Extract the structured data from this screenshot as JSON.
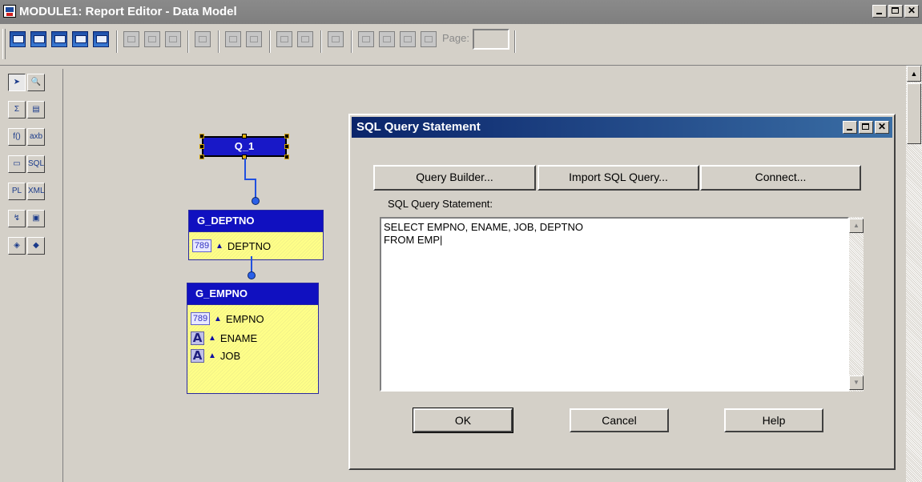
{
  "window": {
    "title": "MODULE1: Report Editor - Data Model",
    "controls": [
      "minimize",
      "maximize",
      "close"
    ]
  },
  "toolbar": {
    "page_label": "Page:",
    "page_value": ""
  },
  "palette": {
    "tools": [
      "select-tool",
      "magnify-tool",
      "summary-tool",
      "database-column-tool",
      "formula-tool",
      "cross-product-tool",
      "placeholder-tool",
      "sql-query-tool",
      "plsql-query-tool",
      "xml-query-tool",
      "data-link-tool",
      "ref-cursor-tool",
      "cube-tool",
      "group-tool"
    ]
  },
  "model": {
    "query": {
      "label": "Q_1"
    },
    "groups": [
      {
        "name": "G_DEPTNO",
        "items": [
          {
            "type": "number",
            "icon_text": "789",
            "label": "DEPTNO"
          }
        ]
      },
      {
        "name": "G_EMPNO",
        "items": [
          {
            "type": "number",
            "icon_text": "789",
            "label": "EMPNO"
          },
          {
            "type": "text",
            "icon_text": "A",
            "label": "ENAME"
          },
          {
            "type": "text",
            "icon_text": "A",
            "label": "JOB"
          }
        ]
      }
    ]
  },
  "dialog": {
    "title": "SQL Query Statement",
    "buttons": {
      "query_builder": "Query Builder...",
      "import_sql": "Import SQL Query...",
      "connect": "Connect...",
      "ok": "OK",
      "cancel": "Cancel",
      "help": "Help"
    },
    "sql_label": "SQL Query Statement:",
    "sql_text": "SELECT EMPNO, ENAME, JOB, DEPTNO\nFROM EMP|"
  },
  "colors": {
    "title_inactive": "#808080",
    "dialog_title": "#0a246a",
    "query_box": "#1818c8",
    "group_body": "#ffff88"
  }
}
